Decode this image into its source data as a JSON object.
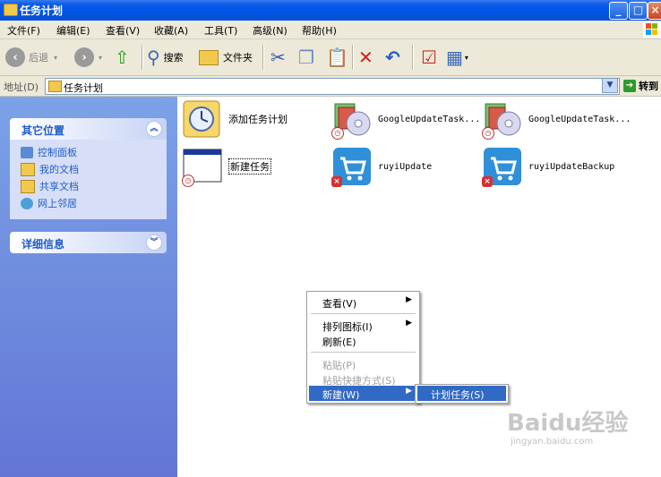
{
  "window": {
    "title": "任务计划"
  },
  "menubar": [
    "文件(F)",
    "编辑(E)",
    "查看(V)",
    "收藏(A)",
    "工具(T)",
    "高级(N)",
    "帮助(H)"
  ],
  "toolbar": {
    "back": "后退",
    "search": "搜索",
    "folders": "文件夹"
  },
  "address": {
    "label": "地址(D)",
    "value": "任务计划",
    "go": "转到"
  },
  "sidebar": {
    "other_places": {
      "title": "其它位置",
      "items": [
        "控制面板",
        "我的文档",
        "共享文档",
        "网上邻居"
      ]
    },
    "details": {
      "title": "详细信息"
    }
  },
  "tasks": [
    {
      "label": "添加任务计划"
    },
    {
      "label": "GoogleUpdateTask..."
    },
    {
      "label": "GoogleUpdateTask..."
    },
    {
      "label": "新建任务"
    },
    {
      "label": "ruyiUpdate"
    },
    {
      "label": "ruyiUpdateBackup"
    }
  ],
  "context_menu": {
    "items": [
      "查看(V)",
      "排列图标(I)",
      "刷新(E)",
      "粘贴(P)",
      "粘贴快捷方式(S)",
      "新建(W)"
    ],
    "submenu": [
      "计划任务(S)"
    ]
  },
  "watermark": {
    "brand": "Baidu经验",
    "url": "jingyan.baidu.com"
  },
  "colors": {
    "xp_blue": "#0055e5",
    "sidebar_link": "#215dc6",
    "menu_highlight": "#316ac5"
  }
}
